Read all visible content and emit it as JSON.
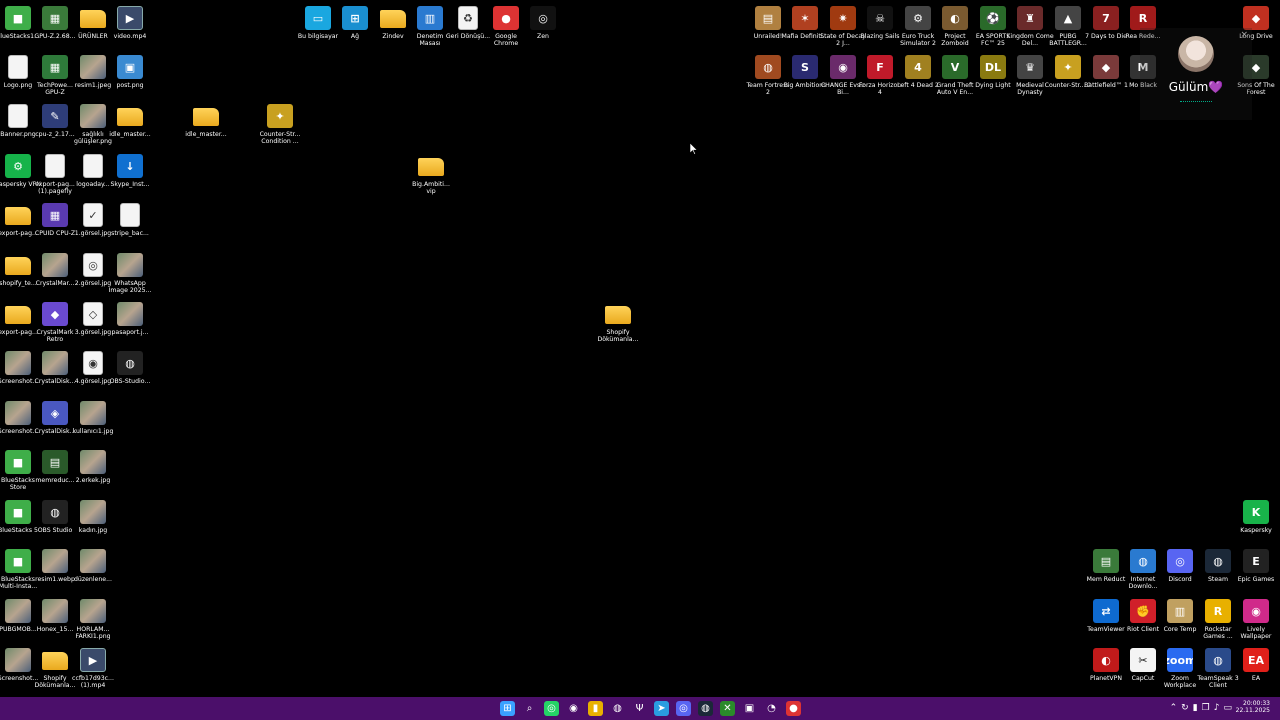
{
  "desktop": {
    "icons": [
      {
        "label": "BlueStacks1...",
        "type": "app",
        "glyph": "■",
        "color": "#3fae49",
        "name": "bluestacks-icon"
      },
      {
        "label": "GPU-Z.2.68...",
        "type": "app",
        "glyph": "▦",
        "color": "#3a7a3a",
        "name": "gpu-z-icon"
      },
      {
        "label": "ÜRÜNLER",
        "type": "folder",
        "glyph": "",
        "color": "",
        "name": "folder-icon"
      },
      {
        "label": "video.mp4",
        "type": "video",
        "glyph": "▶",
        "color": "",
        "name": "video-file-icon"
      },
      {
        "label": "Logo.png",
        "type": "doc",
        "glyph": "",
        "color": "",
        "name": "image-file-icon"
      },
      {
        "label": "TechPowe... GPU-Z",
        "type": "app",
        "glyph": "▦",
        "color": "#2e7a3a",
        "name": "gpu-z-icon"
      },
      {
        "label": "resim1.jpeg",
        "type": "image",
        "glyph": "",
        "color": "",
        "name": "image-file-icon"
      },
      {
        "label": "post.png",
        "type": "app",
        "glyph": "▣",
        "color": "#3a8ad1",
        "name": "image-file-icon"
      },
      {
        "label": "Banner.png",
        "type": "doc",
        "glyph": "",
        "color": "",
        "name": "image-file-icon"
      },
      {
        "label": "cpu-z_2.17...",
        "type": "app",
        "glyph": "✎",
        "color": "#2e3d78",
        "name": "cpu-z-icon"
      },
      {
        "label": "sağlıklı gülüşler.png",
        "type": "image",
        "glyph": "",
        "color": "",
        "name": "image-file-icon"
      },
      {
        "label": "idle_master...",
        "type": "folder",
        "glyph": "",
        "color": "",
        "name": "folder-icon"
      },
      {
        "label": "Kaspersky VPN",
        "type": "app",
        "glyph": "⚙",
        "color": "#16b34a",
        "name": "kaspersky-vpn-icon"
      },
      {
        "label": "export-pag... (1).pagefly",
        "type": "doc",
        "glyph": "",
        "color": "",
        "name": "document-icon"
      },
      {
        "label": "logoaday...",
        "type": "doc",
        "glyph": "",
        "color": "",
        "name": "image-file-icon"
      },
      {
        "label": "Skype_Inst...",
        "type": "app",
        "glyph": "↓",
        "color": "#1070d0",
        "name": "installer-icon"
      },
      {
        "label": "export-pag...",
        "type": "folder",
        "glyph": "",
        "color": "",
        "name": "folder-icon"
      },
      {
        "label": "CPUID CPU-Z",
        "type": "app",
        "glyph": "▦",
        "color": "#5a3ab0",
        "name": "cpu-z-icon"
      },
      {
        "label": "1.görsel.jpg",
        "type": "doc",
        "glyph": "✓",
        "color": "",
        "name": "image-file-icon"
      },
      {
        "label": "stripe_bac...",
        "type": "doc",
        "glyph": "",
        "color": "",
        "name": "document-icon"
      },
      {
        "label": "shopify_te...",
        "type": "folder",
        "glyph": "",
        "color": "",
        "name": "folder-icon"
      },
      {
        "label": "CrystalMar...",
        "type": "image",
        "glyph": "",
        "color": "",
        "name": "crystalmark-icon"
      },
      {
        "label": "2.görsel.jpg",
        "type": "doc",
        "glyph": "◎",
        "color": "",
        "name": "image-file-icon"
      },
      {
        "label": "WhatsApp Image 2025...",
        "type": "image",
        "glyph": "",
        "color": "",
        "name": "image-file-icon"
      },
      {
        "label": "export-pag...",
        "type": "folder",
        "glyph": "",
        "color": "",
        "name": "folder-icon"
      },
      {
        "label": "CrystalMark Retro",
        "type": "app",
        "glyph": "◆",
        "color": "#6a4ad0",
        "name": "crystalmark-icon"
      },
      {
        "label": "3.görsel.jpg",
        "type": "doc",
        "glyph": "◇",
        "color": "",
        "name": "image-file-icon"
      },
      {
        "label": "pasaport.j...",
        "type": "image",
        "glyph": "",
        "color": "",
        "name": "image-file-icon"
      },
      {
        "label": "Screenshot...",
        "type": "image",
        "glyph": "",
        "color": "",
        "name": "image-file-icon"
      },
      {
        "label": "CrystalDisk...",
        "type": "image",
        "glyph": "",
        "color": "",
        "name": "crystaldisk-icon"
      },
      {
        "label": "4.görsel.jpg",
        "type": "doc",
        "glyph": "◉",
        "color": "",
        "name": "image-file-icon"
      },
      {
        "label": "OBS-Studio...",
        "type": "app",
        "glyph": "◍",
        "color": "#222",
        "name": "obs-icon"
      },
      {
        "label": "Screenshot...",
        "type": "image",
        "glyph": "",
        "color": "",
        "name": "image-file-icon"
      },
      {
        "label": "CrystalDisk...",
        "type": "app",
        "glyph": "◈",
        "color": "#4a58c0",
        "name": "crystaldisk-icon"
      },
      {
        "label": "kullanıcı1.jpg",
        "type": "image",
        "glyph": "",
        "color": "",
        "name": "image-file-icon"
      },
      {
        "label": "BlueStacks Store",
        "type": "app",
        "glyph": "■",
        "color": "#3fae49",
        "name": "bluestacks-icon"
      },
      {
        "label": "memreduc...",
        "type": "app",
        "glyph": "▤",
        "color": "#2a5a2a",
        "name": "memreduct-icon"
      },
      {
        "label": "2.erkek.jpg",
        "type": "image",
        "glyph": "",
        "color": "",
        "name": "image-file-icon"
      },
      {
        "label": "BlueStacks 5",
        "type": "app",
        "glyph": "■",
        "color": "#3fae49",
        "name": "bluestacks-icon"
      },
      {
        "label": "OBS Studio",
        "type": "app",
        "glyph": "◍",
        "color": "#222",
        "name": "obs-icon"
      },
      {
        "label": "kadın.jpg",
        "type": "image",
        "glyph": "",
        "color": "",
        "name": "image-file-icon"
      },
      {
        "label": "BlueStacks Multi-Insta...",
        "type": "app",
        "glyph": "■",
        "color": "#3fae49",
        "name": "bluestacks-icon"
      },
      {
        "label": "resim1.webp",
        "type": "image",
        "glyph": "",
        "color": "",
        "name": "image-file-icon"
      },
      {
        "label": "düzenlene...",
        "type": "image",
        "glyph": "",
        "color": "",
        "name": "image-file-icon"
      },
      {
        "label": "PUBGMOB...",
        "type": "image",
        "glyph": "",
        "color": "",
        "name": "image-file-icon"
      },
      {
        "label": "Honex_15...",
        "type": "image",
        "glyph": "",
        "color": "",
        "name": "image-file-icon"
      },
      {
        "label": "HORLAM... FARKI1.png",
        "type": "image",
        "glyph": "",
        "color": "",
        "name": "image-file-icon"
      },
      {
        "label": "Screenshot...",
        "type": "image",
        "glyph": "",
        "color": "",
        "name": "image-file-icon"
      },
      {
        "label": "Shopify Dökümanla...",
        "type": "folder",
        "glyph": "",
        "color": "",
        "name": "folder-icon"
      },
      {
        "label": "ccfb17d93c... (1).mp4",
        "type": "video",
        "glyph": "▶",
        "color": "",
        "name": "video-file-icon"
      },
      {
        "label": "idle_master...",
        "type": "folder",
        "glyph": "",
        "color": "",
        "name": "folder-icon"
      },
      {
        "label": "Counter-Str... Condition ...",
        "type": "game",
        "glyph": "✦",
        "color": "#c8a020",
        "name": "counter-strike-icon"
      },
      {
        "label": "Big.Ambiti... vip",
        "type": "folder",
        "glyph": "",
        "color": "",
        "name": "folder-icon"
      },
      {
        "label": "Shopify Dökümanla...",
        "type": "folder",
        "glyph": "",
        "color": "",
        "name": "folder-icon"
      },
      {
        "label": "Bu bilgisayar",
        "type": "app",
        "glyph": "▭",
        "color": "#1aa7e0",
        "name": "this-pc-icon"
      },
      {
        "label": "Ağ",
        "type": "app",
        "glyph": "⊞",
        "color": "#1a8fd0",
        "name": "network-icon"
      },
      {
        "label": "Zindev",
        "type": "folder",
        "glyph": "",
        "color": "",
        "name": "folder-icon"
      },
      {
        "label": "Denetim Masası",
        "type": "app",
        "glyph": "▥",
        "color": "#2a7ad0",
        "name": "control-panel-icon"
      },
      {
        "label": "Geri Dönüşü...",
        "type": "doc",
        "glyph": "♻",
        "color": "",
        "name": "recycle-bin-icon"
      },
      {
        "label": "Google Chrome",
        "type": "app",
        "glyph": "●",
        "color": "#d33",
        "name": "chrome-icon"
      },
      {
        "label": "Zen",
        "type": "app",
        "glyph": "◎",
        "color": "#111",
        "name": "zen-browser-icon"
      },
      {
        "label": "Unrailed!",
        "type": "game",
        "glyph": "▤",
        "color": "#b08040",
        "name": "game-icon"
      },
      {
        "label": "Mafia Definiti...",
        "type": "game",
        "glyph": "✶",
        "color": "#b04020",
        "name": "game-icon"
      },
      {
        "label": "State of Decay 2 J...",
        "type": "game",
        "glyph": "✷",
        "color": "#a03a10",
        "name": "game-icon"
      },
      {
        "label": "Blazing Sails",
        "type": "game",
        "glyph": "☠",
        "color": "#111",
        "name": "game-icon"
      },
      {
        "label": "Euro Truck Simulator 2",
        "type": "game",
        "glyph": "⚙",
        "color": "#444",
        "name": "game-icon"
      },
      {
        "label": "Project Zomboid",
        "type": "game",
        "glyph": "◐",
        "color": "#7a5a30",
        "name": "game-icon"
      },
      {
        "label": "EA SPORTS FC™ 25",
        "type": "game",
        "glyph": "⚽",
        "color": "#2a6a2a",
        "name": "game-icon"
      },
      {
        "label": "Kingdom Come Del...",
        "type": "game",
        "glyph": "♜",
        "color": "#6a2a2a",
        "name": "game-icon"
      },
      {
        "label": "PUBG BATTLEGR...",
        "type": "game",
        "glyph": "▲",
        "color": "#444",
        "name": "game-icon"
      },
      {
        "label": "7 Days to Die",
        "type": "game",
        "glyph": "7",
        "color": "#8a2020",
        "name": "game-icon"
      },
      {
        "label": "Rea Rede...",
        "type": "game",
        "glyph": "R",
        "color": "#a01a1a",
        "name": "game-icon"
      },
      {
        "label": "Team Fortress 2",
        "type": "game",
        "glyph": "◍",
        "color": "#a04a20",
        "name": "game-icon"
      },
      {
        "label": "Big Ambitions",
        "type": "game",
        "glyph": "S",
        "color": "#2a2a70",
        "name": "game-icon"
      },
      {
        "label": "CHANGE Evsiz Bi...",
        "type": "game",
        "glyph": "◉",
        "color": "#6a2a6a",
        "name": "game-icon"
      },
      {
        "label": "Forza Horizon 4",
        "type": "game",
        "glyph": "F",
        "color": "#c01a2a",
        "name": "game-icon"
      },
      {
        "label": "Left 4 Dead 2",
        "type": "game",
        "glyph": "4",
        "color": "#a08020",
        "name": "game-icon"
      },
      {
        "label": "Grand Theft Auto V En...",
        "type": "game",
        "glyph": "V",
        "color": "#2a6a2a",
        "name": "game-icon"
      },
      {
        "label": "Dying Light",
        "type": "game",
        "glyph": "DL",
        "color": "#8a7a10",
        "name": "game-icon"
      },
      {
        "label": "Medieval Dynasty",
        "type": "game",
        "glyph": "♛",
        "color": "#444",
        "name": "game-icon"
      },
      {
        "label": "Counter-Str... 2",
        "type": "game",
        "glyph": "✦",
        "color": "#c8a020",
        "name": "counter-strike-icon"
      },
      {
        "label": "Battlefield™ 1",
        "type": "game",
        "glyph": "◆",
        "color": "#7a3a3a",
        "name": "game-icon"
      },
      {
        "label": "Mo Black",
        "type": "game",
        "glyph": "M",
        "color": "#333",
        "name": "game-icon"
      },
      {
        "label": "Sons Of The Forest",
        "type": "game",
        "glyph": "◆",
        "color": "#2a3a2a",
        "name": "game-icon"
      },
      {
        "label": "Long Drive",
        "type": "game",
        "glyph": "◆",
        "color": "#c03020",
        "name": "game-icon"
      },
      {
        "label": "Kaspersky",
        "type": "app",
        "glyph": "K",
        "color": "#18b34a",
        "name": "kaspersky-icon"
      },
      {
        "label": "Mem Reduct",
        "type": "app",
        "glyph": "▤",
        "color": "#3a7a3a",
        "name": "memreduct-icon"
      },
      {
        "label": "Internet Downlo...",
        "type": "app",
        "glyph": "◍",
        "color": "#2a7ad0",
        "name": "idm-icon"
      },
      {
        "label": "Discord",
        "type": "app",
        "glyph": "◎",
        "color": "#5865f2",
        "name": "discord-icon"
      },
      {
        "label": "Steam",
        "type": "app",
        "glyph": "◍",
        "color": "#1b2838",
        "name": "steam-icon"
      },
      {
        "label": "Epic Games",
        "type": "app",
        "glyph": "E",
        "color": "#222",
        "name": "epic-games-icon"
      },
      {
        "label": "TeamViewer",
        "type": "app",
        "glyph": "⇄",
        "color": "#0e6ad0",
        "name": "teamviewer-icon"
      },
      {
        "label": "Riot Client",
        "type": "app",
        "glyph": "✊",
        "color": "#d0202a",
        "name": "riot-client-icon"
      },
      {
        "label": "Core Temp",
        "type": "app",
        "glyph": "▥",
        "color": "#c0a060",
        "name": "core-temp-icon"
      },
      {
        "label": "Rockstar Games ...",
        "type": "app",
        "glyph": "R",
        "color": "#e8b000",
        "name": "rockstar-icon"
      },
      {
        "label": "Lively Wallpaper",
        "type": "app",
        "glyph": "◉",
        "color": "#d02a8a",
        "name": "lively-wallpaper-icon"
      },
      {
        "label": "PlanetVPN",
        "type": "app",
        "glyph": "◐",
        "color": "#c01a1a",
        "name": "planetvpn-icon"
      },
      {
        "label": "CapCut",
        "type": "app",
        "glyph": "✂",
        "color": "#f4f4f4",
        "name": "capcut-icon"
      },
      {
        "label": "Zoom Workplace",
        "type": "app",
        "glyph": "zoom",
        "color": "#2a6af0",
        "name": "zoom-icon"
      },
      {
        "label": "TeamSpeak 3 Client",
        "type": "app",
        "glyph": "◍",
        "color": "#2a4a8a",
        "name": "teamspeak-icon"
      },
      {
        "label": "EA",
        "type": "app",
        "glyph": "EA",
        "color": "#e0201a",
        "name": "ea-icon"
      }
    ]
  },
  "profile_card": {
    "name": "Gülüm💜",
    "close_glyph": "×"
  },
  "taskbar": {
    "color": "#4b0f6a",
    "apps": [
      {
        "glyph": "⊞",
        "color": "#3aa0ff",
        "name": "start-icon"
      },
      {
        "glyph": "⌕",
        "color": "transparent",
        "name": "search-icon"
      },
      {
        "glyph": "◎",
        "color": "#25d366",
        "name": "whatsapp-icon"
      },
      {
        "glyph": "◉",
        "color": "transparent",
        "name": "zen-browser-icon"
      },
      {
        "glyph": "▮",
        "color": "#e8b000",
        "name": "file-explorer-icon"
      },
      {
        "glyph": "◍",
        "color": "transparent",
        "name": "obs-icon"
      },
      {
        "glyph": "Ψ",
        "color": "transparent",
        "name": "capcut-icon"
      },
      {
        "glyph": "➤",
        "color": "#2a9de0",
        "name": "telegram-icon"
      },
      {
        "glyph": "◎",
        "color": "#5865f2",
        "name": "discord-icon"
      },
      {
        "glyph": "◍",
        "color": "#1b2838",
        "name": "steam-icon"
      },
      {
        "glyph": "✕",
        "color": "#2a8a2a",
        "name": "excel-icon"
      },
      {
        "glyph": "▣",
        "color": "transparent",
        "name": "app-icon"
      },
      {
        "glyph": "◔",
        "color": "transparent",
        "name": "settings-icon"
      },
      {
        "glyph": "●",
        "color": "#d33",
        "name": "chrome-icon"
      }
    ],
    "tray": [
      {
        "glyph": "⌃",
        "name": "chevron-up-icon"
      },
      {
        "glyph": "↻",
        "name": "sync-icon"
      },
      {
        "glyph": "▮",
        "name": "microphone-icon"
      },
      {
        "glyph": "❐",
        "name": "network-icon"
      },
      {
        "glyph": "♪",
        "name": "volume-icon"
      },
      {
        "glyph": "▭",
        "name": "battery-icon"
      }
    ],
    "time": "20:00:33",
    "date": "22.11.2025"
  }
}
